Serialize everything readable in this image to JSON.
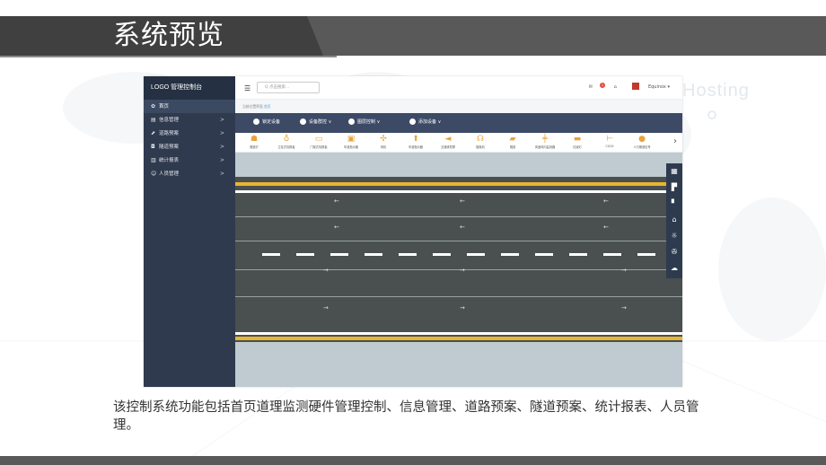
{
  "slide": {
    "title": "系统预览",
    "ghost_text": "Hosting",
    "caption": "该控制系统功能包括首页道理监测硬件管理控制、信息管理、道路预案、隧道预案、统计报表、人员管理。"
  },
  "app": {
    "logo": "LOGO  管理控制台",
    "search_placeholder": "Q  点击搜索...",
    "user": "Equinox",
    "mail_badge": "1",
    "breadcrumb_prefix": "当前位置界面",
    "breadcrumb_current": "首页",
    "sidebar": [
      {
        "icon": "home-icon",
        "glyph": "✿",
        "label": "首页",
        "active": true,
        "arrow": ""
      },
      {
        "icon": "list-icon",
        "glyph": "▤",
        "label": "信息管理",
        "active": false,
        "arrow": ">"
      },
      {
        "icon": "road-icon",
        "glyph": "⬈",
        "label": "道路预案",
        "active": false,
        "arrow": ">"
      },
      {
        "icon": "tunnel-icon",
        "glyph": "◘",
        "label": "隧道预案",
        "active": false,
        "arrow": ">"
      },
      {
        "icon": "chart-icon",
        "glyph": "▥",
        "label": "统计报表",
        "active": false,
        "arrow": ">"
      },
      {
        "icon": "users-icon",
        "glyph": "☺",
        "label": "人员管理",
        "active": false,
        "arrow": ">"
      }
    ],
    "toolbar": [
      {
        "label": "锁定设备"
      },
      {
        "label": "设备群控 ∨"
      },
      {
        "label": "图层控制 ∨"
      },
      {
        "label": "添加设备 ∨"
      }
    ],
    "devices": [
      "隧道灯",
      "立柱式情报板",
      "门架式情报板",
      "车道指示器",
      "风机",
      "车道指示器",
      "交通诱导屏",
      "摄像机",
      "隧道",
      "风速风向监测器",
      "红绿灯",
      "CO/VI",
      "人行横道信号"
    ],
    "right_panel": [
      "▦",
      "▛",
      "▘",
      "⌂",
      "☼",
      "✇",
      "☁"
    ]
  },
  "colors": {
    "sidebar": "#2f3a4e",
    "toolbar": "#3c4a66",
    "road": "#4a4f4f",
    "road_yellow": "#e8b530",
    "title_band": "#595959"
  }
}
